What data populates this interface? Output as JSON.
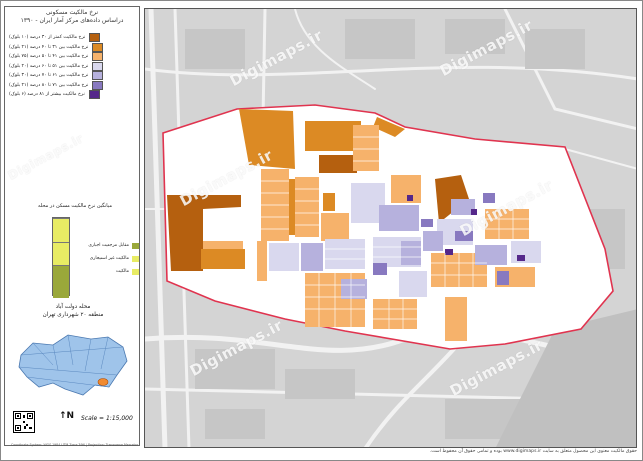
{
  "panel": {
    "title_line1": "نرخ مالکیت مسکونی",
    "title_line2": "دراساس داده‌های مرکز آمار ایران - ۱۳۹۰"
  },
  "legend": [
    {
      "label": "نرخ مالکیت کمتر از ۳۰ درصد (۱۰ بلوک)",
      "color": "#b5600f"
    },
    {
      "label": "نرخ مالکیت بین ۳۱ تا ۴۰ درصد (۲۱ بلوک)",
      "color": "#dc8a24"
    },
    {
      "label": "نرخ مالکیت بین ۴۱ تا ۵۰ درصد (۷۵ بلوک)",
      "color": "#f6b26b"
    },
    {
      "label": "نرخ مالکیت بین ۵۱ تا ۶۰ درصد (۲۰ بلوک)",
      "color": "#d9d8ee"
    },
    {
      "label": "نرخ مالکیت بین ۶۱ تا ۷۰ درصد (۳۰ بلوک)",
      "color": "#b6b1dd"
    },
    {
      "label": "نرخ مالکیت بین ۷۱ تا ۸۰ درصد (۲۱ بلوک)",
      "color": "#8879c0"
    },
    {
      "label": "نرخ مالکیت بیشتر از ۸۱ درصد (۶ بلوک)",
      "color": "#55288a"
    }
  ],
  "bar_chart": {
    "title": "میانگین نرخ مالکیت مسکن در محله",
    "segments": [
      {
        "label": "مقابل مرجعیت اجباری",
        "color": "#9aa83a",
        "share": 0.42
      },
      {
        "label": "مالکیت غیر استیجاری",
        "color": "#e8ec64",
        "share": 0.28
      },
      {
        "label": "مالکیت",
        "color": "#e8ec64",
        "share": 0.3
      }
    ]
  },
  "district": {
    "line1": "محله دولت آباد",
    "line2": "منطقه ۲۰ شهرداری تهران"
  },
  "scale": "Scale = 1:15,000",
  "north": "N",
  "tiny_note": "Coordinate System: WGS 1984 UTM Zone 39N | Projection: Transverse Mercator",
  "watermark": "Digimaps.ir",
  "credit": "حقوق مالکیت معنوی این محصول متعلق به سایت www.digimaps.ir بوده و تمامی حقوق آن محفوظ است.",
  "colors": {
    "study_boundary": "#e0344f",
    "background": "#d4d4d4"
  }
}
